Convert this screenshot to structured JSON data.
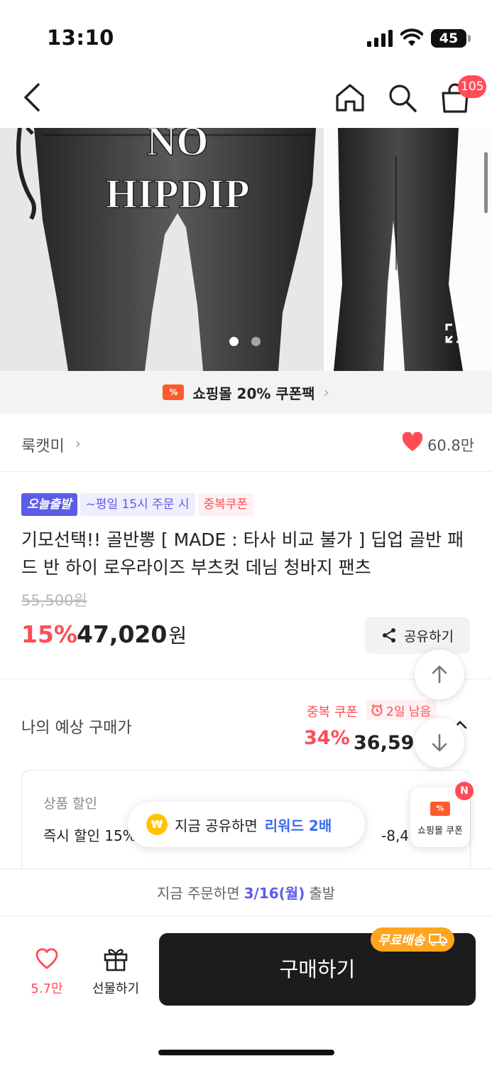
{
  "status_bar": {
    "time": "13:10",
    "battery": "45"
  },
  "nav": {
    "cart_count": "105"
  },
  "hero": {
    "overlay_text_line1": "NO",
    "overlay_text_line2": "HIPDIP",
    "page_count": 2,
    "active_page": 1
  },
  "coupon_banner": {
    "icon_text": "%",
    "text": "쇼핑몰 20% 쿠폰팩",
    "chevron": "›"
  },
  "store": {
    "name": "룩캣미",
    "chevron": "›",
    "likes": "60.8만"
  },
  "badges": {
    "today": "오늘출발",
    "weekday": "~평일 15시 주문 시",
    "dup_coupon": "중복쿠폰"
  },
  "product": {
    "title": "기모선택!! 골반뽕 [ MADE : 타사 비교 불가 ] 딥업 골반 패드 반 하이 로우라이즈 부츠컷 데님 청바지 팬츠",
    "original_price": "55,500원",
    "discount": "15%",
    "price_number": "47,020",
    "price_unit": "원"
  },
  "share": {
    "label": "공유하기"
  },
  "expected": {
    "label": "나의 예상 구매가",
    "dup_coupon": "중복 쿠폰",
    "days_left": "2일 남음",
    "discount": "34%",
    "price": "36,590원"
  },
  "discount_box": {
    "section_label": "상품 할인",
    "instant_label": "즉시 할인 15%",
    "instant_value": "-8,480원"
  },
  "reward_toast": {
    "coin": "₩",
    "text": "지금 공유하면",
    "highlight": "리워드 2배"
  },
  "mall_coupon": {
    "icon_text": "%",
    "label": "쇼핑몰 쿠폰",
    "dot": "N"
  },
  "ship_notice": {
    "prefix": "지금 주문하면",
    "date": "3/16(월)",
    "suffix": "출발"
  },
  "bottom_bar": {
    "wish_count": "5.7만",
    "gift_label": "선물하기",
    "buy_label": "구매하기",
    "free_ship": "무료배송"
  },
  "colors": {
    "accent": "#ff4c57",
    "brand_purple": "#5c5ce8",
    "buy_button": "#1c1c1c",
    "free_ship": "#ffa51f"
  }
}
